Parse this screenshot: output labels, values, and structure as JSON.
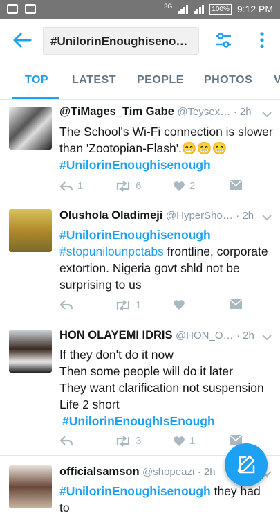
{
  "status_bar": {
    "network": "3G",
    "battery": "100%",
    "time": "9:12 PM"
  },
  "search": {
    "query": "#UnilorinEnoughisenough"
  },
  "tabs": [
    "TOP",
    "LATEST",
    "PEOPLE",
    "PHOTOS",
    "V"
  ],
  "tweets": [
    {
      "name": "@TiMages_Tim Gabe",
      "handle": "@Teysex…",
      "time": "· 2h",
      "text_plain": "The  School's Wi-Fi connection is slower than 'Zootopian-Flash'.😁😁😁",
      "hashtag": "#UnilorinEnoughisenough",
      "replies": "1",
      "retweets": "6",
      "likes": "2"
    },
    {
      "name": "Olushola Oladimeji",
      "handle": "@HyperSho…",
      "time": "· 2h",
      "hashtag": "#UnilorinEnoughisenough",
      "hashtag2": "#stopuniloun pctabs",
      "hashtag2_text": "#stopunilounpctabs",
      "text_plain": " frontline, corporate extortion. Nigeria govt shld not be surprising to us",
      "replies": "",
      "retweets": "1",
      "likes": ""
    },
    {
      "name": "HON OLAYEMI IDRIS",
      "handle": "@HON_O…",
      "time": "· 2h",
      "lines": [
        "If they don't do it now",
        "Then some people will do it later",
        "They want clarification not suspension",
        "Life 2 short"
      ],
      "hashtag": "#UnilorinEnoughIsEnough",
      "replies": "",
      "retweets": "3",
      "likes": "1"
    },
    {
      "name": "officialsamson",
      "handle": "@shopeazi",
      "time": "· 2h",
      "hashtag": "#UnilorinEnoughisenough",
      "text_plain": " they had to"
    }
  ],
  "colors": {
    "accent": "#1da1f2",
    "status_bar": "#757575",
    "muted": "#8899a6"
  }
}
